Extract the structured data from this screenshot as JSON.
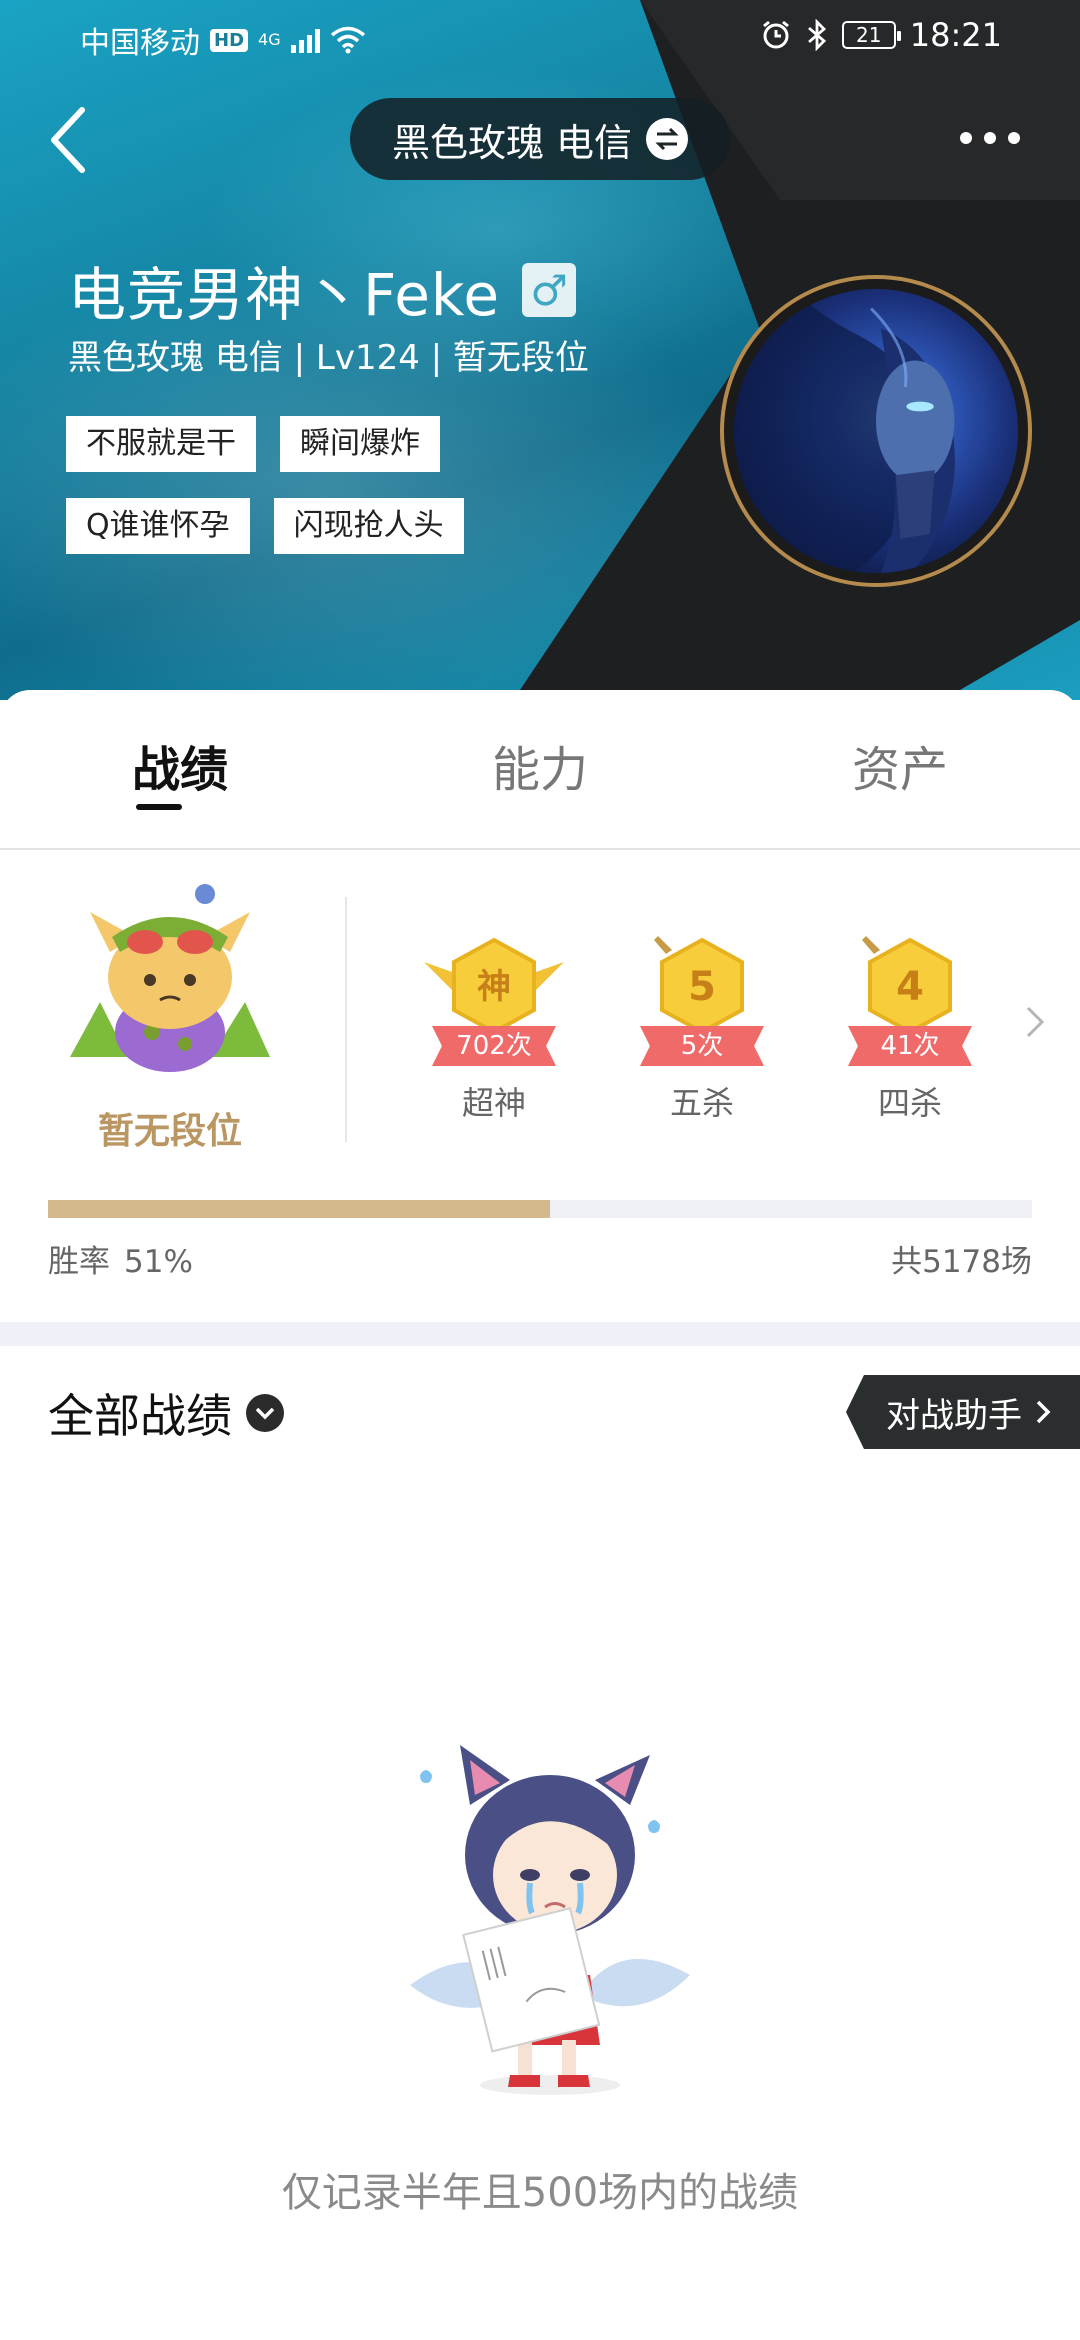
{
  "status_bar": {
    "carrier": "中国移动",
    "hd": "HD",
    "network": "4G",
    "battery": "21",
    "time": "18:21"
  },
  "header": {
    "server": "黑色玫瑰 电信",
    "nickname": "电竞男神丶Feke",
    "gender_symbol": "♂",
    "subinfo": "黑色玫瑰 电信 | Lv124 | 暂无段位",
    "tags": [
      "不服就是干",
      "瞬间爆炸",
      "Q谁谁怀孕",
      "闪现抢人头"
    ],
    "colors": {
      "accent_teal": "#1584a3",
      "dark_panel": "#1e1f20",
      "avatar_ring": "#b48a4d"
    }
  },
  "tabs": [
    {
      "label": "战绩",
      "active": true
    },
    {
      "label": "能力",
      "active": false
    },
    {
      "label": "资产",
      "active": false
    }
  ],
  "stats": {
    "rank_label": "暂无段位",
    "achievements": [
      {
        "badge_char": "神",
        "count": "702次",
        "label": "超神"
      },
      {
        "badge_char": "5",
        "count": "5次",
        "label": "五杀"
      },
      {
        "badge_char": "4",
        "count": "41次",
        "label": "四杀"
      }
    ],
    "win_rate_label": "胜率",
    "win_rate_value": "51%",
    "win_rate_fraction": 0.51,
    "total_games": "共5178场",
    "colors": {
      "progress_fill": "#d3b98b",
      "rank_text": "#b99662",
      "count_ribbon": "#f16a6a"
    }
  },
  "records": {
    "title": "全部战绩",
    "assistant_label": "对战助手",
    "empty_message": "仅记录半年且500场内的战绩"
  }
}
